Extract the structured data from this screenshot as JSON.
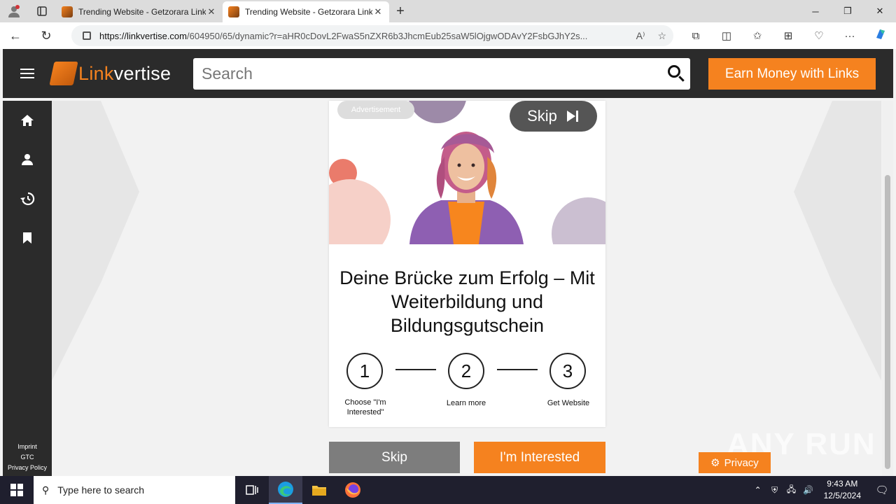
{
  "browser": {
    "tabs": [
      {
        "title": "Trending Website - Getzorara Link"
      },
      {
        "title": "Trending Website - Getzorara Link"
      }
    ],
    "url_domain": "https://linkvertise.com",
    "url_path": "/604950/65/dynamic?r=aHR0cDovL2FwaS5nZXR6b3JhcmEub25saW5lOjgwODAvY2FsbGJhY2s..."
  },
  "site": {
    "logo_link": "Link",
    "logo_vertise": "vertise",
    "search_placeholder": "Search",
    "earn_button": "Earn Money with Links",
    "sidebar_footer": [
      "Imprint",
      "GTC",
      "Privacy Policy"
    ]
  },
  "ad": {
    "badge": "Advertisement",
    "skip_label": "Skip",
    "headline": "Deine Brücke zum Erfolg – Mit Weiterbildung und Bildungsgutschein",
    "steps": [
      {
        "num": "1",
        "label": "Choose \"I'm Interested\""
      },
      {
        "num": "2",
        "label": "Learn more"
      },
      {
        "num": "3",
        "label": "Get Website"
      }
    ]
  },
  "actions": {
    "skip": "Skip",
    "interested": "I'm Interested",
    "privacy": "Privacy"
  },
  "watermark": "ANY RUN",
  "taskbar": {
    "search_placeholder": "Type here to search",
    "time": "9:43 AM",
    "date": "12/5/2024"
  },
  "colors": {
    "accent": "#f5821f",
    "header": "#2b2b2b"
  }
}
